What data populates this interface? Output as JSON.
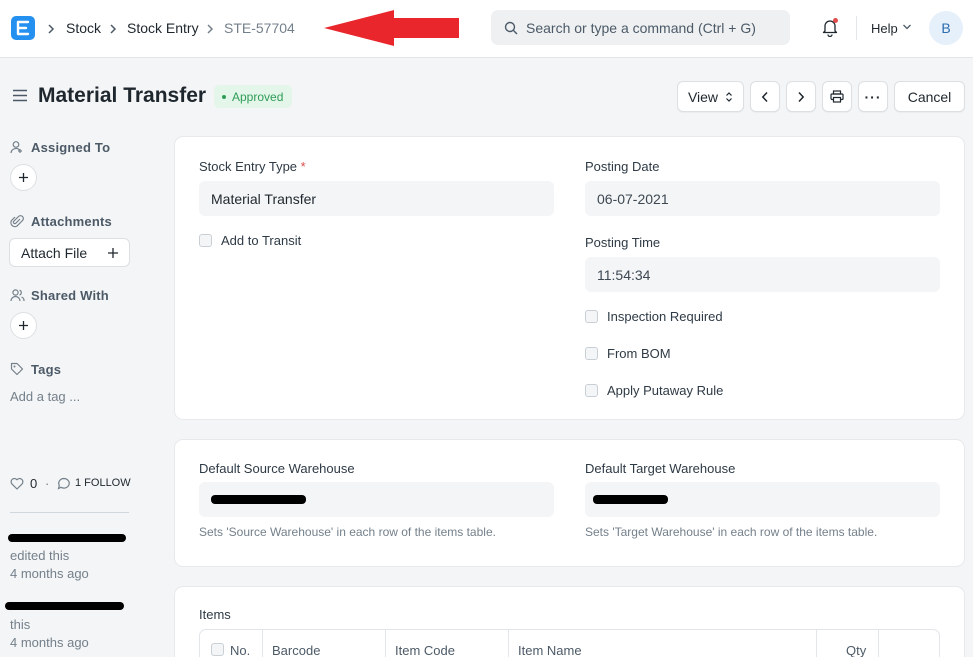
{
  "navbar": {
    "breadcrumbs": [
      "Stock",
      "Stock Entry",
      "STE-57704"
    ],
    "search_placeholder": "Search or type a command (Ctrl + G)",
    "help_label": "Help",
    "avatar_initial": "B"
  },
  "header": {
    "title": "Material Transfer",
    "status": "Approved",
    "view_label": "View",
    "cancel_label": "Cancel",
    "more_label": "···"
  },
  "sidebar": {
    "assigned_to": "Assigned To",
    "attachments": "Attachments",
    "attach_file": "Attach File",
    "shared_with": "Shared With",
    "tags": "Tags",
    "add_tag": "Add a tag ...",
    "likes": "0",
    "follow": "1 FOLLOW",
    "activity": [
      {
        "action": "edited this",
        "time": "4 months ago"
      },
      {
        "action": "this",
        "time": "4 months ago"
      }
    ]
  },
  "form": {
    "stock_entry_type_label": "Stock Entry Type",
    "required_mark": "*",
    "stock_entry_type": "Material Transfer",
    "add_to_transit": "Add to Transit",
    "posting_date_label": "Posting Date",
    "posting_date": "06-07-2021",
    "posting_time_label": "Posting Time",
    "posting_time": "11:54:34",
    "inspection_required": "Inspection Required",
    "from_bom": "From BOM",
    "apply_putaway_rule": "Apply Putaway Rule"
  },
  "warehouses": {
    "source_label": "Default Source Warehouse",
    "source_desc": "Sets 'Source Warehouse' in each row of the items table.",
    "target_label": "Default Target Warehouse",
    "target_desc": "Sets 'Target Warehouse' in each row of the items table."
  },
  "items": {
    "label": "Items",
    "columns": [
      "No.",
      "Barcode",
      "Item Code",
      "Item Name",
      "Qty"
    ]
  },
  "colors": {
    "primary": "#2490ef",
    "success": "#2f9d58",
    "annotation_arrow": "#e8262b"
  }
}
